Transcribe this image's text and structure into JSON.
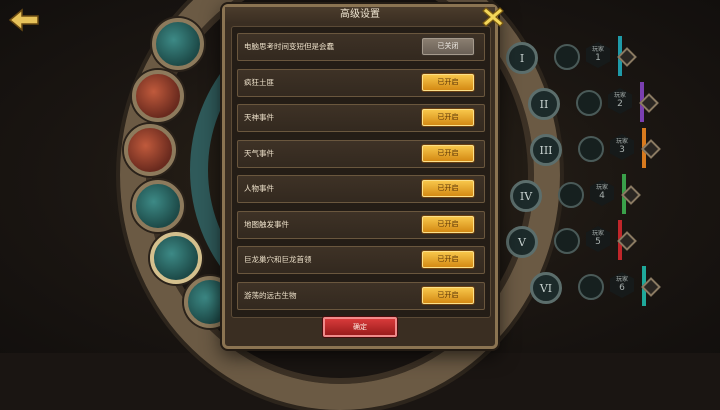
{
  "dialog": {
    "title": "高级设置",
    "confirm_label": "确定",
    "settings": [
      {
        "label": "电脑思考时间变短但是会蠢",
        "state": "已关闭",
        "on": false
      },
      {
        "label": "疯狂土匪",
        "state": "已开启",
        "on": true
      },
      {
        "label": "天神事件",
        "state": "已开启",
        "on": true
      },
      {
        "label": "天气事件",
        "state": "已开启",
        "on": true
      },
      {
        "label": "人物事件",
        "state": "已开启",
        "on": true
      },
      {
        "label": "地图触发事件",
        "state": "已开启",
        "on": true
      },
      {
        "label": "巨龙巢穴和巨龙首领",
        "state": "已开启",
        "on": true
      },
      {
        "label": "游荡的远古生物",
        "state": "已开启",
        "on": true
      }
    ]
  },
  "slots": {
    "roman": [
      "I",
      "II",
      "III",
      "IV",
      "V",
      "VI"
    ],
    "hex_labels": [
      "1",
      "2",
      "3",
      "4",
      "5",
      "6"
    ],
    "hex_prefix": "玩家",
    "strip_colors": [
      "#1f9aa8",
      "#7a3fb0",
      "#d87a1e",
      "#3aa04a",
      "#c0262a",
      "#1fa89a"
    ]
  },
  "icons": {
    "back": "back-arrow-icon",
    "close": "close-x-icon"
  },
  "colors": {
    "toggle_on": "#e6a52a",
    "toggle_off": "#7a7064",
    "confirm": "#c02a2a",
    "frame": "#8b7452"
  }
}
